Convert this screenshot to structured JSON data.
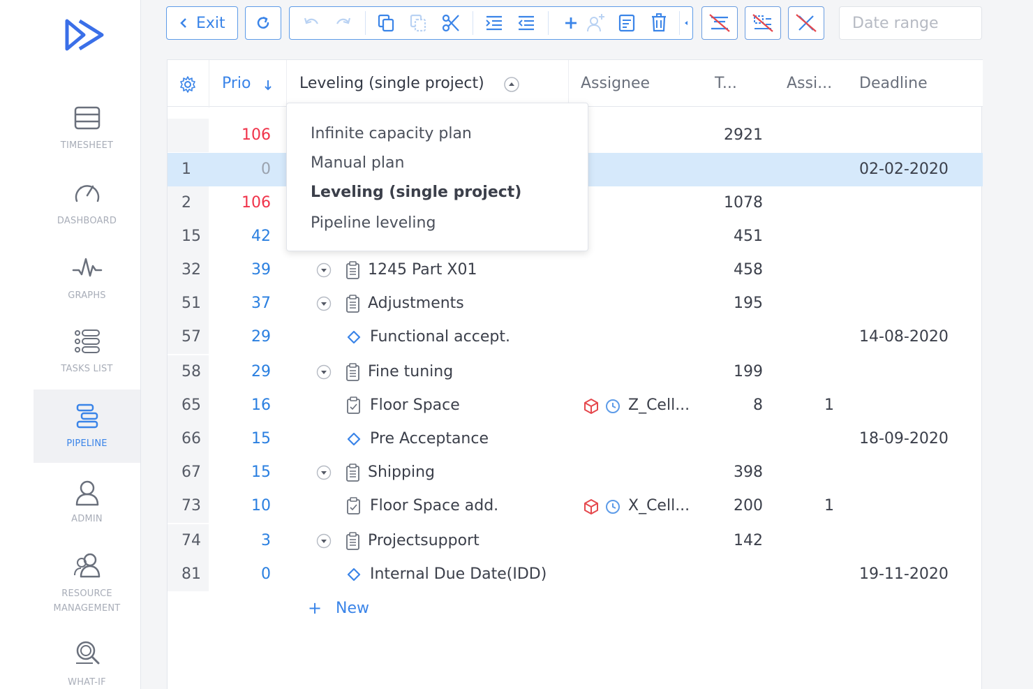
{
  "sidebar": {
    "items": [
      {
        "label": "TIMESHEET",
        "icon": "timesheet-icon"
      },
      {
        "label": "DASHBOARD",
        "icon": "dashboard-icon"
      },
      {
        "label": "GRAPHS",
        "icon": "graphs-icon"
      },
      {
        "label": "TASKS LIST",
        "icon": "tasks-list-icon"
      },
      {
        "label": "PIPELINE",
        "icon": "pipeline-icon",
        "active": true
      },
      {
        "label": "ADMIN",
        "icon": "admin-icon"
      },
      {
        "label": "RESOURCE",
        "label2": "MANAGEMENT",
        "icon": "resource-management-icon"
      },
      {
        "label": "WHAT-IF",
        "icon": "what-if-icon"
      }
    ]
  },
  "toolbar": {
    "exit_label": "Exit",
    "date_range_placeholder": "Date range"
  },
  "table": {
    "headers": {
      "prio": "Prio",
      "leveling": "Leveling (single project)",
      "assignee": "Assignee",
      "t": "T...",
      "assi": "Assi...",
      "deadline": "Deadline"
    },
    "rows": [
      {
        "idx": "",
        "prio": "106",
        "prio_color": "red",
        "name": "",
        "t": "2921",
        "a": "",
        "deadline": ""
      },
      {
        "idx": "1",
        "prio": "0",
        "prio_color": "grey",
        "name": "",
        "t": "",
        "a": "",
        "deadline": "02-02-2020",
        "selected": true
      },
      {
        "idx": "2",
        "prio": "106",
        "prio_color": "red",
        "name": "",
        "t": "1078",
        "a": "",
        "deadline": ""
      },
      {
        "idx": "15",
        "prio": "42",
        "prio_color": "blue",
        "name": "",
        "t": "451",
        "a": "",
        "deadline": ""
      },
      {
        "idx": "32",
        "prio": "39",
        "prio_color": "blue",
        "name": "1245 Part X01",
        "type": "group",
        "t": "458",
        "a": "",
        "deadline": ""
      },
      {
        "idx": "51",
        "prio": "37",
        "prio_color": "blue",
        "name": "Adjustments",
        "type": "group",
        "t": "195",
        "a": "",
        "deadline": ""
      },
      {
        "idx": "57",
        "prio": "29",
        "prio_color": "blue",
        "name": "Functional accept.",
        "type": "milestone",
        "t": "",
        "a": "",
        "deadline": "14-08-2020"
      },
      {
        "idx": "58",
        "prio": "29",
        "prio_color": "blue",
        "name": "Fine tuning",
        "type": "group",
        "t": "199",
        "a": "",
        "deadline": ""
      },
      {
        "idx": "65",
        "prio": "16",
        "prio_color": "blue",
        "name": "Floor Space",
        "type": "task",
        "assignee": "Z_Cell...",
        "t": "8",
        "a": "1",
        "deadline": ""
      },
      {
        "idx": "66",
        "prio": "15",
        "prio_color": "blue",
        "name": "Pre Acceptance",
        "type": "milestone",
        "t": "",
        "a": "",
        "deadline": "18-09-2020"
      },
      {
        "idx": "67",
        "prio": "15",
        "prio_color": "blue",
        "name": "Shipping",
        "type": "group",
        "t": "398",
        "a": "",
        "deadline": ""
      },
      {
        "idx": "73",
        "prio": "10",
        "prio_color": "blue",
        "name": "Floor Space add.",
        "type": "task",
        "assignee": "X_Cell...",
        "t": "200",
        "a": "1",
        "deadline": ""
      },
      {
        "idx": "74",
        "prio": "3",
        "prio_color": "blue",
        "name": "Projectsupport",
        "type": "group",
        "t": "142",
        "a": "",
        "deadline": ""
      },
      {
        "idx": "81",
        "prio": "0",
        "prio_color": "blue",
        "name": "Internal Due Date(IDD)",
        "type": "milestone",
        "t": "",
        "a": "",
        "deadline": "19-11-2020"
      }
    ],
    "new_label": "New"
  },
  "dropdown": {
    "options": [
      {
        "label": "Infinite capacity plan"
      },
      {
        "label": "Manual plan"
      },
      {
        "label": "Leveling (single project)",
        "selected": true
      },
      {
        "label": "Pipeline leveling"
      }
    ]
  },
  "colors": {
    "accent": "#3a84e8",
    "priority_red": "#f0334a",
    "priority_blue": "#2a7fe0",
    "selected_row": "#d6e9fb",
    "resource_icon": "#e5484d"
  }
}
